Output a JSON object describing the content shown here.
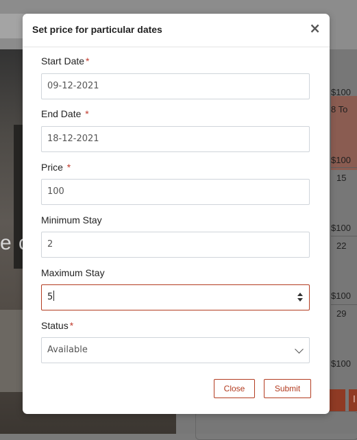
{
  "background": {
    "hero_fragment": "e c",
    "calendar": {
      "prices": [
        "$100",
        "$100",
        "$100",
        "$100",
        "$100"
      ],
      "days": [
        "8 To",
        "15",
        "22",
        "29"
      ]
    },
    "buttons": [
      "rs",
      "I"
    ]
  },
  "modal": {
    "title": "Set price for particular dates",
    "close_symbol": "×",
    "required_marker": "*",
    "start_date": {
      "label": "Start Date",
      "value": "09-12-2021"
    },
    "end_date": {
      "label": "End Date",
      "value": "18-12-2021"
    },
    "price": {
      "label": "Price",
      "value": "100"
    },
    "min_stay": {
      "label": "Minimum Stay",
      "value": "2"
    },
    "max_stay": {
      "label": "Maximum Stay",
      "value": "5"
    },
    "status": {
      "label": "Status",
      "value": "Available"
    },
    "close_label": "Close",
    "submit_label": "Submit"
  },
  "colors": {
    "accent": "#b23a1e",
    "required": "#c0392b",
    "overlay": "#7a7a7a"
  }
}
